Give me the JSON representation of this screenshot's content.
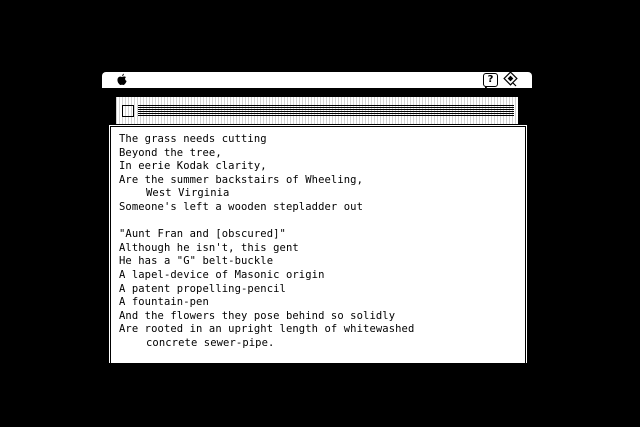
{
  "menubar": {
    "apple_icon": "apple-icon",
    "help_icon": "balloon-help-icon",
    "help_glyph": "?",
    "app_icon": "application-menu-icon"
  },
  "background_window": {
    "title": ""
  },
  "document": {
    "lines": [
      {
        "text": "The grass needs cutting",
        "indent": false
      },
      {
        "text": "Beyond the tree,",
        "indent": false
      },
      {
        "text": "In eerie Kodak clarity,",
        "indent": false
      },
      {
        "text": "Are the summer backstairs of Wheeling,",
        "indent": false
      },
      {
        "text": "West Virginia",
        "indent": true
      },
      {
        "text": "Someone's left a wooden stepladder out",
        "indent": false
      },
      {
        "text": "",
        "indent": false
      },
      {
        "text": "\"Aunt Fran and [obscured]\"",
        "indent": false
      },
      {
        "text": "Although he isn't, this gent",
        "indent": false
      },
      {
        "text": "He has a \"G\" belt-buckle",
        "indent": false
      },
      {
        "text": "A lapel-device of Masonic origin",
        "indent": false
      },
      {
        "text": "A patent propelling-pencil",
        "indent": false
      },
      {
        "text": "A fountain-pen",
        "indent": false
      },
      {
        "text": "And the flowers they pose behind so solidly",
        "indent": false
      },
      {
        "text": "Are rooted in an upright length of whitewashed",
        "indent": false
      },
      {
        "text": "concrete sewer-pipe.",
        "indent": true
      }
    ]
  },
  "colors": {
    "screen_bg": "#000000",
    "window_bg": "#ffffff",
    "ink": "#000000"
  }
}
